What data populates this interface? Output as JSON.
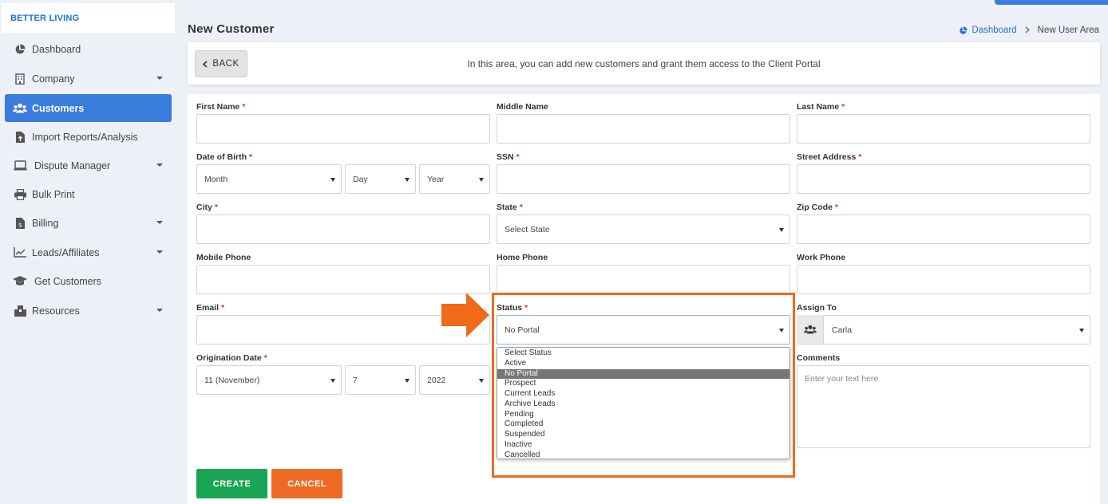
{
  "brand": "BETTER LIVING",
  "sidebar": {
    "items": [
      {
        "label": "Dashboard",
        "icon": "pie-chart-icon"
      },
      {
        "label": "Company",
        "icon": "building-icon"
      },
      {
        "label": "Customers",
        "icon": "users-icon"
      },
      {
        "label": "Import Reports/Analysis",
        "icon": "file-import-icon"
      },
      {
        "label": "Dispute Manager",
        "icon": "laptop-icon"
      },
      {
        "label": "Bulk Print",
        "icon": "printer-icon"
      },
      {
        "label": "Billing",
        "icon": "invoice-icon"
      },
      {
        "label": "Leads/Affiliates",
        "icon": "line-chart-icon"
      },
      {
        "label": "Get Customers",
        "icon": "graduation-cap-icon"
      },
      {
        "label": "Resources",
        "icon": "box-icon"
      }
    ]
  },
  "header": {
    "title": "New Customer",
    "breadcrumb": {
      "home": "Dashboard",
      "current": "New User Area"
    }
  },
  "info": {
    "back_label": "BACK",
    "message": "In this area, you can add new customers and grant them access to the Client Portal"
  },
  "form": {
    "first_name": {
      "label": "First Name",
      "value": ""
    },
    "middle_name": {
      "label": "Middle Name",
      "value": ""
    },
    "last_name": {
      "label": "Last Name",
      "value": ""
    },
    "dob": {
      "label": "Date of Birth",
      "month": "Month",
      "day": "Day",
      "year": "Year"
    },
    "ssn": {
      "label": "SSN",
      "value": ""
    },
    "street": {
      "label": "Street Address",
      "value": ""
    },
    "city": {
      "label": "City",
      "value": ""
    },
    "state": {
      "label": "State",
      "value": "Select State"
    },
    "zip": {
      "label": "Zip Code",
      "value": ""
    },
    "mobile": {
      "label": "Mobile Phone",
      "value": ""
    },
    "home": {
      "label": "Home Phone",
      "value": ""
    },
    "work": {
      "label": "Work Phone",
      "value": ""
    },
    "email": {
      "label": "Email",
      "value": ""
    },
    "status": {
      "label": "Status",
      "value": "No Portal",
      "options": [
        "Select Status",
        "Active",
        "No Portal",
        "Prospect",
        "Current Leads",
        "Archive Leads",
        "Pending",
        "Completed",
        "Suspended",
        "Inactive",
        "Cancelled"
      ]
    },
    "assign_to": {
      "label": "Assign To",
      "value": "Carla"
    },
    "origination": {
      "label": "Origination Date",
      "month": "11 (November)",
      "day": "7",
      "year": "2022"
    },
    "comments": {
      "label": "Comments",
      "placeholder": "Enter your text here"
    },
    "required_mark": "*",
    "create_label": "CREATE",
    "cancel_label": "CANCEL"
  },
  "colors": {
    "accent": "#3b7ddd",
    "create": "#19a553",
    "cancel": "#ef6a25",
    "highlight": "#f06a19"
  }
}
